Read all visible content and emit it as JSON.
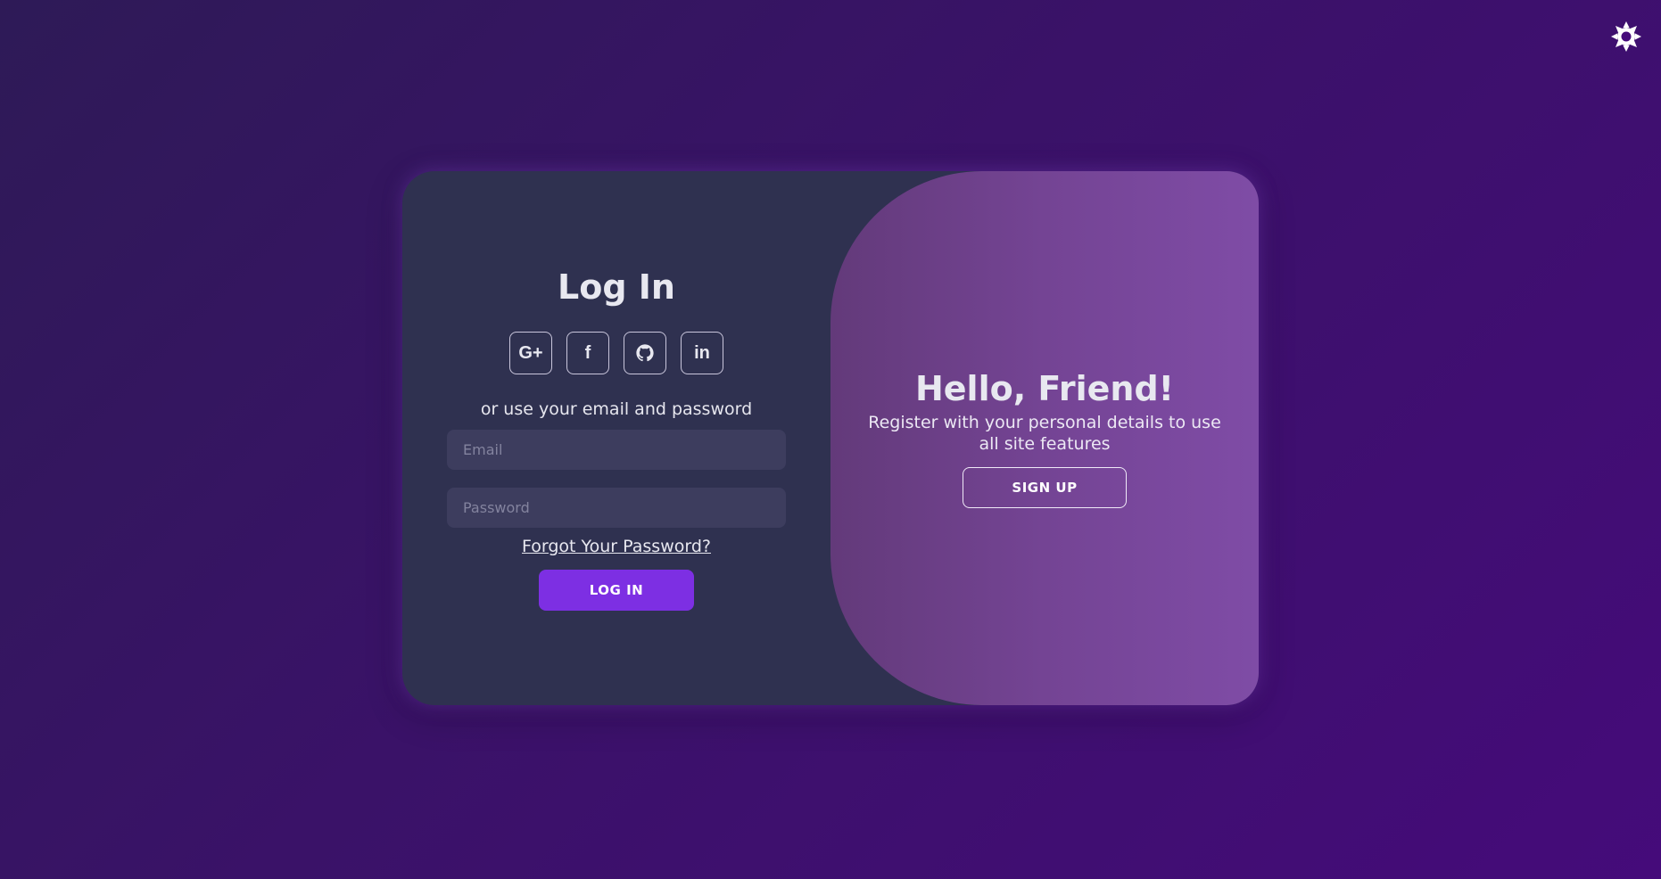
{
  "theme_toggle": {
    "icon": "sun-icon"
  },
  "login": {
    "title": "Log In",
    "social": [
      {
        "name": "google",
        "glyph": "G+",
        "icon": "google-plus-icon"
      },
      {
        "name": "facebook",
        "glyph": "f",
        "icon": "facebook-icon"
      },
      {
        "name": "github",
        "glyph": "",
        "icon": "github-icon"
      },
      {
        "name": "linkedin",
        "glyph": "in",
        "icon": "linkedin-icon"
      }
    ],
    "alt_text": "or use your email and password",
    "email_placeholder": "Email",
    "password_placeholder": "Password",
    "forgot_label": "Forgot Your Password?",
    "submit_label": "LOG IN"
  },
  "signup": {
    "title": "Hello, Friend!",
    "subtitle": "Register with your personal details to use all site features",
    "button_label": "SIGN UP"
  },
  "colors": {
    "background_start": "#2e1a57",
    "background_end": "#450b7a",
    "card": "#2f3150",
    "input_bg": "#3d3d5e",
    "primary_button": "#7d2fe3",
    "accent_panel": "#7f4ca6"
  }
}
